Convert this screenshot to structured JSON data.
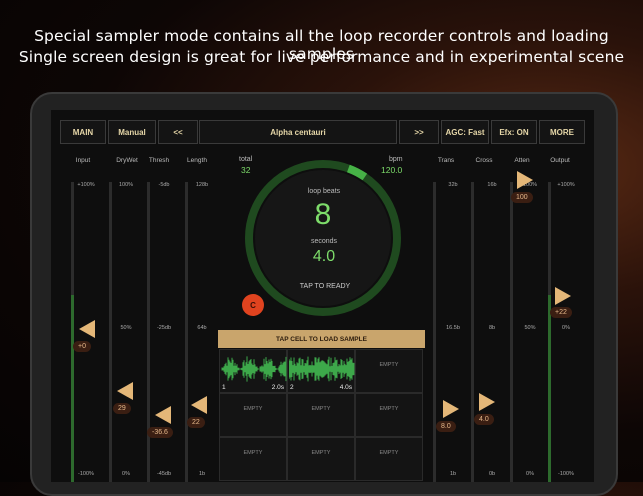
{
  "caption": {
    "line1": "Special sampler mode contains all the loop recorder controls and loading samples",
    "line2": "Single screen design is great for live performance and in experimental scene"
  },
  "topbar": {
    "main": "MAIN",
    "manual": "Manual",
    "prev": "<<",
    "title": "Alpha centauri",
    "next": ">>",
    "agc": "AGC: Fast",
    "efx": "Efx: ON",
    "more": "MORE"
  },
  "left_sliders": [
    {
      "title": "Input",
      "ticks": [
        "+100%",
        "",
        "-100%"
      ],
      "value": "+0"
    },
    {
      "title": "DryWet",
      "ticks": [
        "100%",
        "50%",
        "0%"
      ],
      "value": "29"
    },
    {
      "title": "Thresh",
      "ticks": [
        "-5db",
        "-25db",
        "-45db"
      ],
      "value": "-36.6"
    },
    {
      "title": "Length",
      "ticks": [
        "128b",
        "64b",
        "1b"
      ],
      "value": "22"
    }
  ],
  "right_sliders": [
    {
      "title": "Trans",
      "ticks": [
        "32b",
        "16.5b",
        "1b"
      ],
      "value": "8.0"
    },
    {
      "title": "Cross",
      "ticks": [
        "16b",
        "8b",
        "0b"
      ],
      "value": "4.0"
    },
    {
      "title": "Atten",
      "ticks": [
        "100%",
        "50%",
        "0%"
      ],
      "value": "100"
    },
    {
      "title": "Output",
      "ticks": [
        "+100%",
        "0%",
        "-100%"
      ],
      "value": "+22"
    }
  ],
  "dial": {
    "total_label": "total",
    "total_value": "32",
    "bpm_label": "bpm",
    "bpm_value": "120.0",
    "loop_beats_label": "loop beats",
    "loop_beats_value": "8",
    "seconds_label": "seconds",
    "seconds_value": "4.0",
    "status": "TAP TO READY",
    "progress": 0.04
  },
  "record_button": "C",
  "grid": {
    "header": "TAP CELL TO LOAD SAMPLE",
    "cells": [
      {
        "num": "1",
        "len": "2.0s",
        "empty": ""
      },
      {
        "num": "2",
        "len": "4.0s",
        "empty": ""
      },
      {
        "num": "",
        "len": "",
        "empty": "EMPTY"
      },
      {
        "num": "",
        "len": "",
        "empty": "EMPTY"
      },
      {
        "num": "",
        "len": "",
        "empty": "EMPTY"
      },
      {
        "num": "",
        "len": "",
        "empty": "EMPTY"
      },
      {
        "num": "",
        "len": "",
        "empty": "EMPTY"
      },
      {
        "num": "",
        "len": "",
        "empty": "EMPTY"
      },
      {
        "num": "",
        "len": "",
        "empty": "EMPTY"
      }
    ]
  },
  "colors": {
    "accent": "#e4b778",
    "green": "#7ddc6a",
    "record": "#e0431f"
  }
}
